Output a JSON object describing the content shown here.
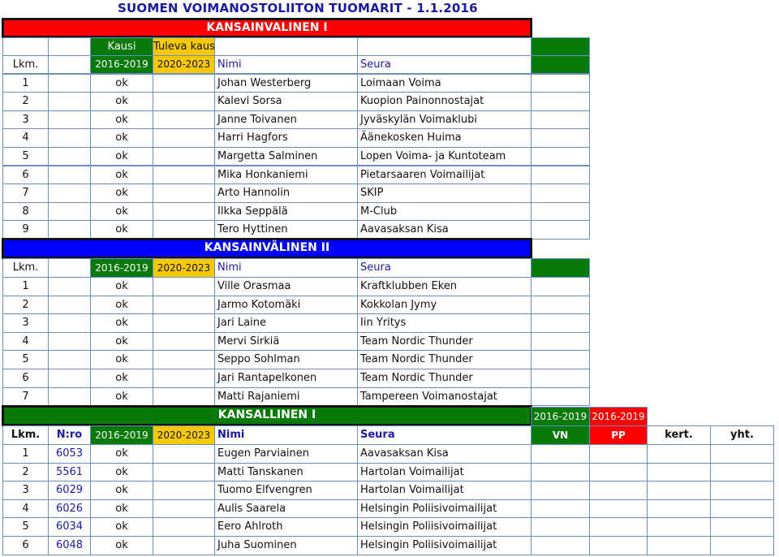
{
  "title": "SUOMEN VOIMANOSTOLIITON TUOMARIT - 1.1.2016",
  "colors": {
    "red": "#ff0000",
    "blue": "#0000ff",
    "green": "#087a0a",
    "yellow": "#f9c900",
    "header_text_blue": "#1a1aa8",
    "grid": "#6b8fc4"
  },
  "sections": [
    {
      "title": "KANSAINVALINEN I",
      "season_labels": {
        "current": "Kausi",
        "next": "Tuleva kausi"
      },
      "headers": {
        "lkm": "Lkm.",
        "current": "2016-2019",
        "next": "2020-2023",
        "name": "Nimi",
        "club": "Seura"
      },
      "rows": [
        {
          "lkm": "1",
          "status": "ok",
          "name": "Johan Westerberg",
          "club": "Loimaan Voima"
        },
        {
          "lkm": "2",
          "status": "ok",
          "name": "Kalevi Sorsa",
          "club": "Kuopion Painonnostajat"
        },
        {
          "lkm": "3",
          "status": "ok",
          "name": "Janne Toivanen",
          "club": "Jyväskylän Voimaklubi"
        },
        {
          "lkm": "4",
          "status": "ok",
          "name": "Harri Hagfors",
          "club": "Äänekosken Huima"
        },
        {
          "lkm": "5",
          "status": "ok",
          "name": "Margetta Salminen",
          "club": "Lopen Voima- ja Kuntoteam"
        },
        {
          "lkm": "6",
          "status": "ok",
          "name": "Mika Honkaniemi",
          "club": "Pietarsaaren Voimailijat"
        },
        {
          "lkm": "7",
          "status": "ok",
          "name": "Arto Hannolin",
          "club": "SKIP"
        },
        {
          "lkm": "8",
          "status": "ok",
          "name": "Ilkka Seppälä",
          "club": "M-Club"
        },
        {
          "lkm": "9",
          "status": "ok",
          "name": "Tero Hyttinen",
          "club": "Aavasaksan Kisa"
        }
      ]
    },
    {
      "title": "KANSAINVÄLINEN II",
      "headers": {
        "lkm": "Lkm.",
        "current": "2016-2019",
        "next": "2020-2023",
        "name": "Nimi",
        "club": "Seura"
      },
      "rows": [
        {
          "lkm": "1",
          "status": "ok",
          "name": "Ville Orasmaa",
          "club": "Kraftklubben Eken"
        },
        {
          "lkm": "2",
          "status": "ok",
          "name": "Jarmo Kotomäki",
          "club": "Kokkolan Jymy"
        },
        {
          "lkm": "3",
          "status": "ok",
          "name": "Jari Laine",
          "club": "Iin Yritys"
        },
        {
          "lkm": "4",
          "status": "ok",
          "name": "Mervi Sirkiä",
          "club": "Team Nordic Thunder"
        },
        {
          "lkm": "5",
          "status": "ok",
          "name": "Seppo Sohlman",
          "club": "Team Nordic Thunder"
        },
        {
          "lkm": "6",
          "status": "ok",
          "name": "Jari Rantapelkonen",
          "club": "Team Nordic Thunder"
        },
        {
          "lkm": "7",
          "status": "ok",
          "name": "Matti Rajaniemi",
          "club": "Tampereen Voimanostajat"
        }
      ]
    },
    {
      "title": "KANSALLINEN I",
      "extra_periods": {
        "vn": "2016-2019",
        "pp": "2016-2019"
      },
      "headers": {
        "lkm": "Lkm.",
        "nro": "N:ro",
        "current": "2016-2019",
        "next": "2020-2023",
        "name": "Nimi",
        "club": "Seura",
        "vn": "VN",
        "pp": "PP",
        "kert": "kert.",
        "yht": "yht."
      },
      "rows": [
        {
          "lkm": "1",
          "nro": "6053",
          "status": "ok",
          "name": "Eugen Parviainen",
          "club": "Aavasaksan Kisa"
        },
        {
          "lkm": "2",
          "nro": "5561",
          "status": "ok",
          "name": "Matti Tanskanen",
          "club": "Hartolan Voimailijat"
        },
        {
          "lkm": "3",
          "nro": "6029",
          "status": "ok",
          "name": "Tuomo Elfvengren",
          "club": "Hartolan Voimailijat"
        },
        {
          "lkm": "4",
          "nro": "6026",
          "status": "ok",
          "name": "Aulis Saarela",
          "club": "Helsingin Poliisivoimailijat"
        },
        {
          "lkm": "5",
          "nro": "6034",
          "status": "ok",
          "name": "Eero Ahlroth",
          "club": "Helsingin Poliisivoimailijat"
        },
        {
          "lkm": "6",
          "nro": "6048",
          "status": "ok",
          "name": "Juha Suominen",
          "club": "Helsingin Poliisivoimailijat"
        }
      ]
    }
  ]
}
